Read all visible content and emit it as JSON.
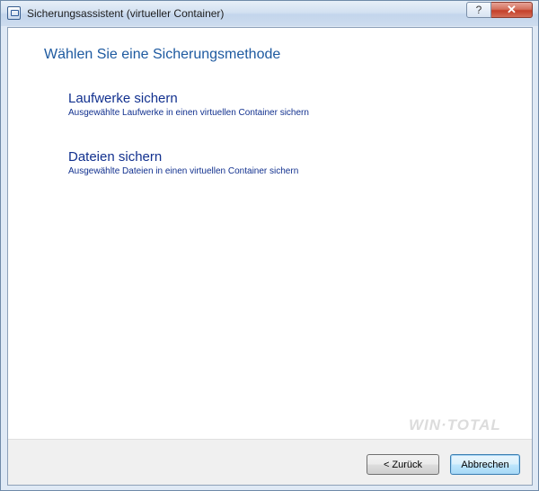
{
  "window": {
    "title": "Sicherungsassistent (virtueller Container)",
    "help_glyph": "?",
    "close_glyph": "✕"
  },
  "page": {
    "heading": "Wählen Sie eine Sicherungsmethode"
  },
  "options": [
    {
      "title": "Laufwerke sichern",
      "description": "Ausgewählte Laufwerke in einen virtuellen Container sichern"
    },
    {
      "title": "Dateien sichern",
      "description": "Ausgewählte Dateien in einen virtuellen Container sichern"
    }
  ],
  "watermark": "WIN·TOTAL",
  "buttons": {
    "back": "< Zurück",
    "cancel": "Abbrechen"
  },
  "colors": {
    "heading": "#1e5aa0",
    "link": "#12318f",
    "close_button": "#c4402a"
  },
  "icons": {
    "app": "container-app-icon",
    "help": "question-icon",
    "close": "close-icon"
  }
}
